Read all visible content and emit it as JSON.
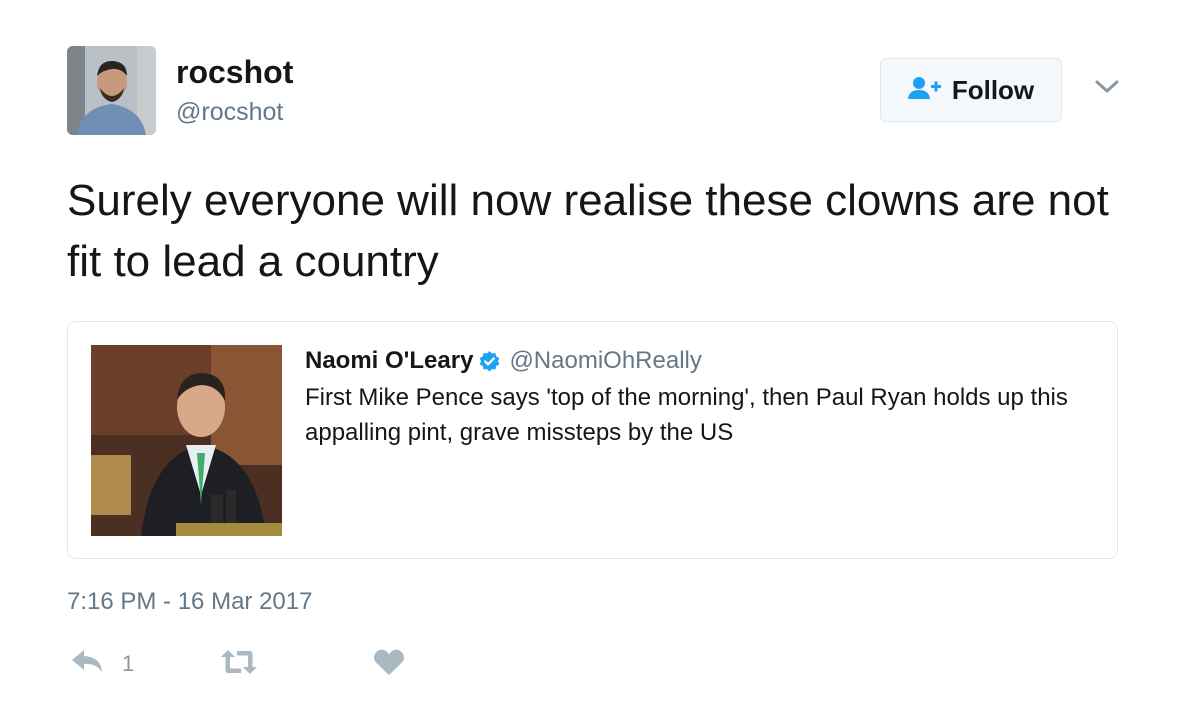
{
  "author": {
    "display_name": "rocshot",
    "screen_name": "@rocshot"
  },
  "follow_button": {
    "label": "Follow",
    "icon": "follow-user-plus-icon"
  },
  "tweet": {
    "text": "Surely everyone will now realise these clowns are not fit to lead a country",
    "timestamp": "7:16 PM - 16 Mar 2017"
  },
  "quoted_tweet": {
    "author_name": "Naomi O'Leary",
    "verified": true,
    "screen_name": "@NaomiOhReally",
    "text": "First Mike Pence says 'top of the morning', then Paul Ryan holds up this appalling pint, grave missteps by the US"
  },
  "actions": {
    "reply_count": "1",
    "reply_icon": "reply-icon",
    "retweet_icon": "retweet-icon",
    "like_icon": "heart-icon"
  },
  "colors": {
    "primary_text": "#14171a",
    "secondary_text": "#657786",
    "action_icon": "#aab8c2",
    "verified_blue": "#1da1f2",
    "border": "#e1e8ed"
  }
}
